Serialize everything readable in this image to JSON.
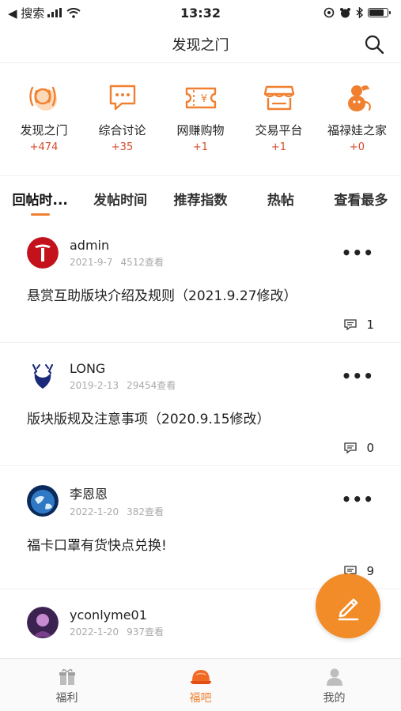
{
  "status_bar": {
    "back_label": "◀ 搜索",
    "time": "13:32"
  },
  "header": {
    "title": "发现之门"
  },
  "categories": [
    {
      "label": "发现之门",
      "count": "+474",
      "icon": "broadcast-icon"
    },
    {
      "label": "综合讨论",
      "count": "+35",
      "icon": "chat-icon"
    },
    {
      "label": "网赚购物",
      "count": "+1",
      "icon": "ticket-icon"
    },
    {
      "label": "交易平台",
      "count": "+1",
      "icon": "shop-icon"
    },
    {
      "label": "福禄娃之家",
      "count": "+0",
      "icon": "gourd-icon"
    }
  ],
  "sort_tabs": [
    "回帖时...",
    "发帖时间",
    "推荐指数",
    "热帖",
    "查看最多"
  ],
  "posts": [
    {
      "author": "admin",
      "date": "2021-9-7",
      "views": "4512查看",
      "title": "悬赏互助版块介绍及规则（2021.9.27修改）",
      "replies": "1"
    },
    {
      "author": "LONG",
      "date": "2019-2-13",
      "views": "29454查看",
      "title": "版块版规及注意事项（2020.9.15修改）",
      "replies": "0"
    },
    {
      "author": "李恩恩",
      "date": "2022-1-20",
      "views": "382查看",
      "title": "福卡口罩有货快点兑换!",
      "replies": "9"
    },
    {
      "author": "yconlyme01",
      "date": "2022-1-20",
      "views": "937查看",
      "title": "",
      "replies": ""
    }
  ],
  "tabbar": [
    {
      "label": "福利",
      "icon": "gift-icon"
    },
    {
      "label": "福吧",
      "icon": "helmet-icon"
    },
    {
      "label": "我的",
      "icon": "person-icon"
    }
  ],
  "colors": {
    "accent": "#f08030",
    "count_red": "#d84a2a"
  }
}
